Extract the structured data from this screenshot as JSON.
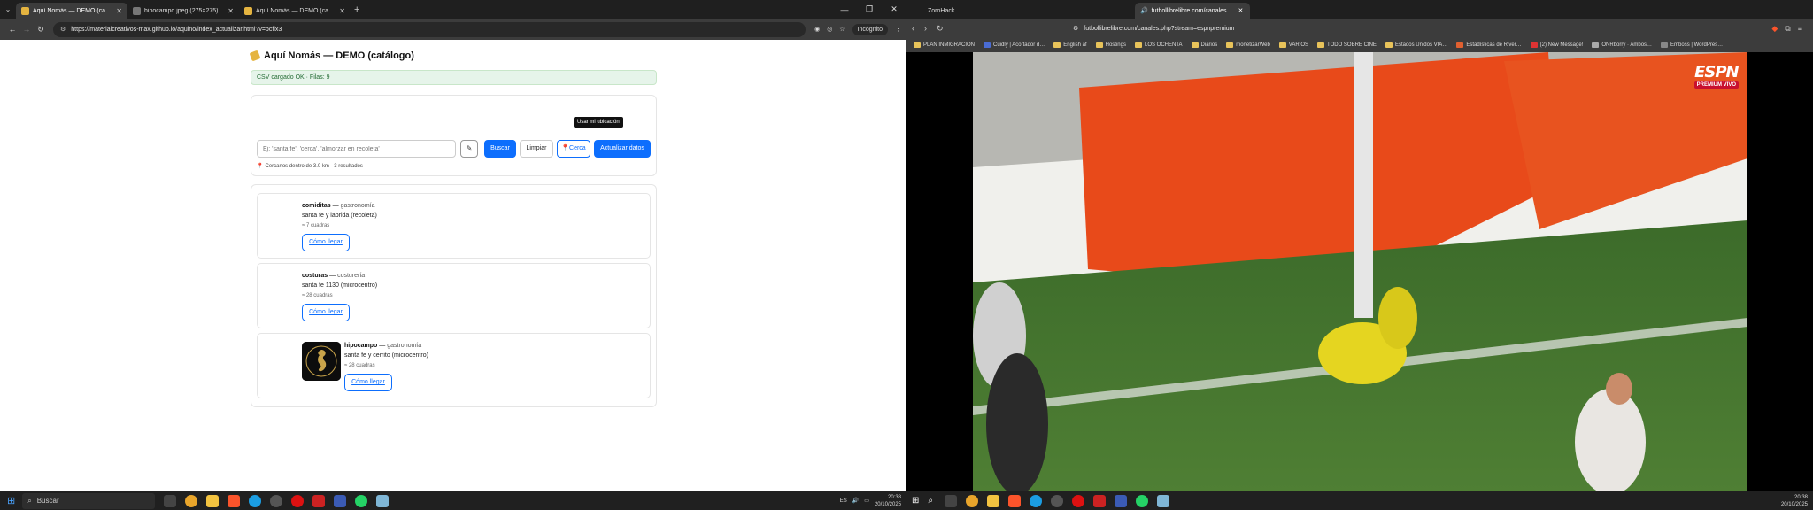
{
  "left_window": {
    "tabs": [
      {
        "label": "Aquí Nomás — DEMO (catálog…",
        "active": true,
        "color": "#e5b440"
      },
      {
        "label": "hipocampo.jpeg (275×275)",
        "active": false,
        "color": "#777777"
      },
      {
        "label": "Aquí Nomás — DEMO (catálog…",
        "active": false,
        "color": "#e5b440"
      }
    ],
    "url": "https://materialcreativos-max.github.io/aquino/index_actualizar.html?v=pcfix3",
    "incognito_label": "Incógnito",
    "page": {
      "title": "Aquí Nomás — DEMO (catálogo)",
      "status": "CSV cargado OK · Filas: 9",
      "search_placeholder": "Ej: 'santa fe', 'cerca', 'almorzar en recoleta'",
      "buttons": {
        "edit_icon": "pencil-icon",
        "search": "Buscar",
        "clear": "Limpiar",
        "near": "Cerca",
        "update": "Actualizar datos"
      },
      "tooltip": "Usar mi ubicación",
      "results_note": "Cercanos dentro de 3.0 km · 3 resultados",
      "results": [
        {
          "name": "comiditas",
          "category": "gastronomía",
          "address": "santa fe y laprida (recoleta)",
          "distance": "≈ 7 cuadras",
          "button": "Cómo llegar"
        },
        {
          "name": "costuras",
          "category": "costurería",
          "address": "santa fe 1130 (microcentro)",
          "distance": "≈ 28 cuadras",
          "button": "Cómo llegar"
        },
        {
          "name": "hipocampo",
          "category": "gastronomía",
          "address": "santa fe y cerrito (microcentro)",
          "distance": "≈ 28 cuadras",
          "button": "Cómo llegar"
        }
      ]
    },
    "taskbar": {
      "search_label": "Buscar",
      "lang": "ES",
      "time": "20:38",
      "date": "20/10/2025"
    }
  },
  "right_window": {
    "tabs": [
      {
        "label": "ZoroHack",
        "active": false
      },
      {
        "label": "futbollibrelibre.com/canales…",
        "active": true
      }
    ],
    "url": "futbollibrelibre.com/canales.php?stream=espnpremium",
    "bookmarks": [
      "PLAN INMIGRACION",
      "Cuidly | Acortador d…",
      "English af",
      "Hostings",
      "LOS OCHENTA",
      "Diarios",
      "monetizarWeb",
      "VARIOS",
      "TODO SOBRE CINE",
      "Estados Unidos VIA…",
      "Estadísticas de River…",
      "(2) New Message!",
      "ONRborry · Ambos…",
      "Emboss | WordPres…"
    ],
    "channel_logo": "ESPN",
    "channel_badge": "PREMIUM VIVO",
    "taskbar": {
      "time": "20:38",
      "date": "20/10/2025"
    }
  },
  "colors": {
    "accent": "#0d6efd",
    "success_bg": "#e6f4ea",
    "espn_red": "#c8102e"
  }
}
